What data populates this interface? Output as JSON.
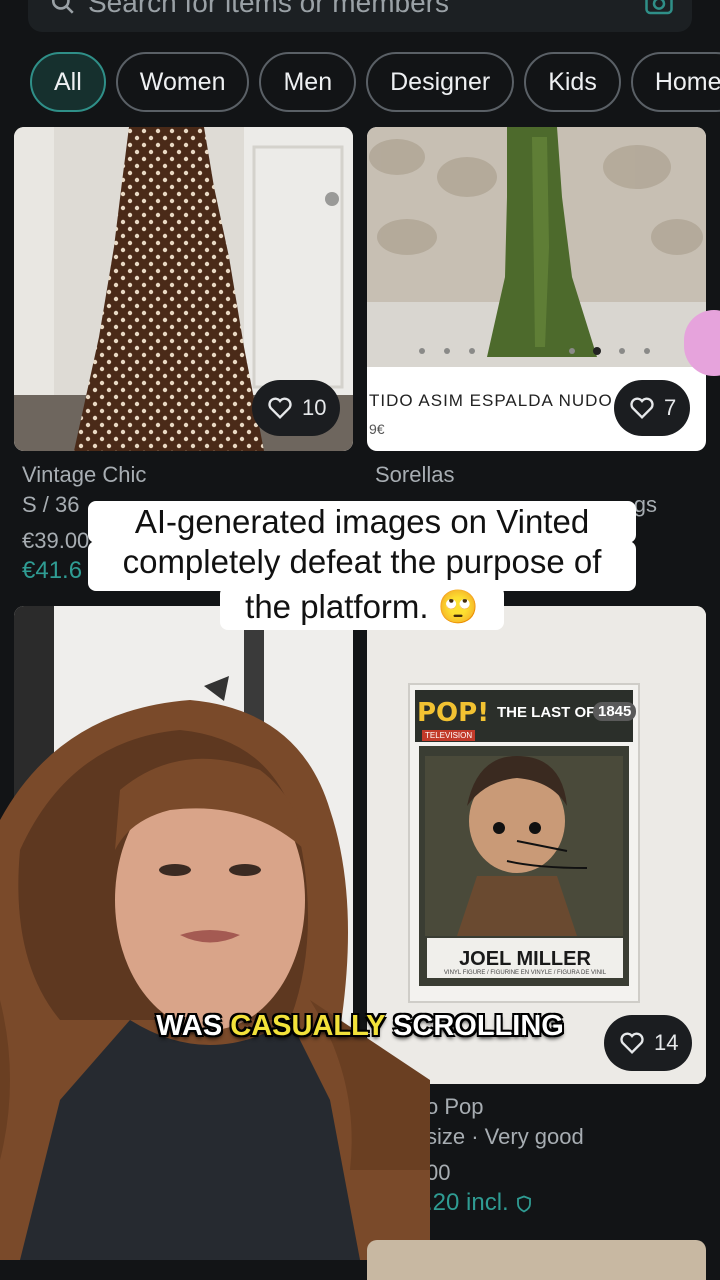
{
  "search": {
    "placeholder": "Search for items or members"
  },
  "chips": [
    "All",
    "Women",
    "Men",
    "Designer",
    "Kids",
    "Home"
  ],
  "items": [
    {
      "likes": "10",
      "brand": "Vintage Chic",
      "size": "S / 36",
      "price": "€39.00",
      "price_incl": "€41.6"
    },
    {
      "likes": "7",
      "brand": "Sorellas",
      "size_tail": "gs",
      "image_caption": "TIDO ASIM ESPALDA NUDO OLIV",
      "image_price": "9€"
    },
    {
      "likes": "14",
      "brand_tail": "o Pop",
      "size_tail": "size · Very good",
      "price_tail": "00",
      "price_incl_tail": ".20 incl."
    }
  ],
  "funko": {
    "brand": "POP!",
    "category": "TELEVISION",
    "series": "THE LAST OF US",
    "number": "1845",
    "character": "JOEL MILLER",
    "fine_print": "VINYL FIGURE / FIGURINE EN VINYLE / FIGURA DE VINIL"
  },
  "overlay": {
    "caption_line1": "AI-generated images on Vinted",
    "caption_line2": "completely defeat the purpose of",
    "caption_line3": "the platform. 🙄",
    "subtitle_pre": "WAS ",
    "subtitle_hl": "CASUALLY",
    "subtitle_post": " SCROLLING"
  },
  "colors": {
    "accent": "#2f8f88",
    "highlight": "#f2e23a",
    "background": "#121416"
  }
}
